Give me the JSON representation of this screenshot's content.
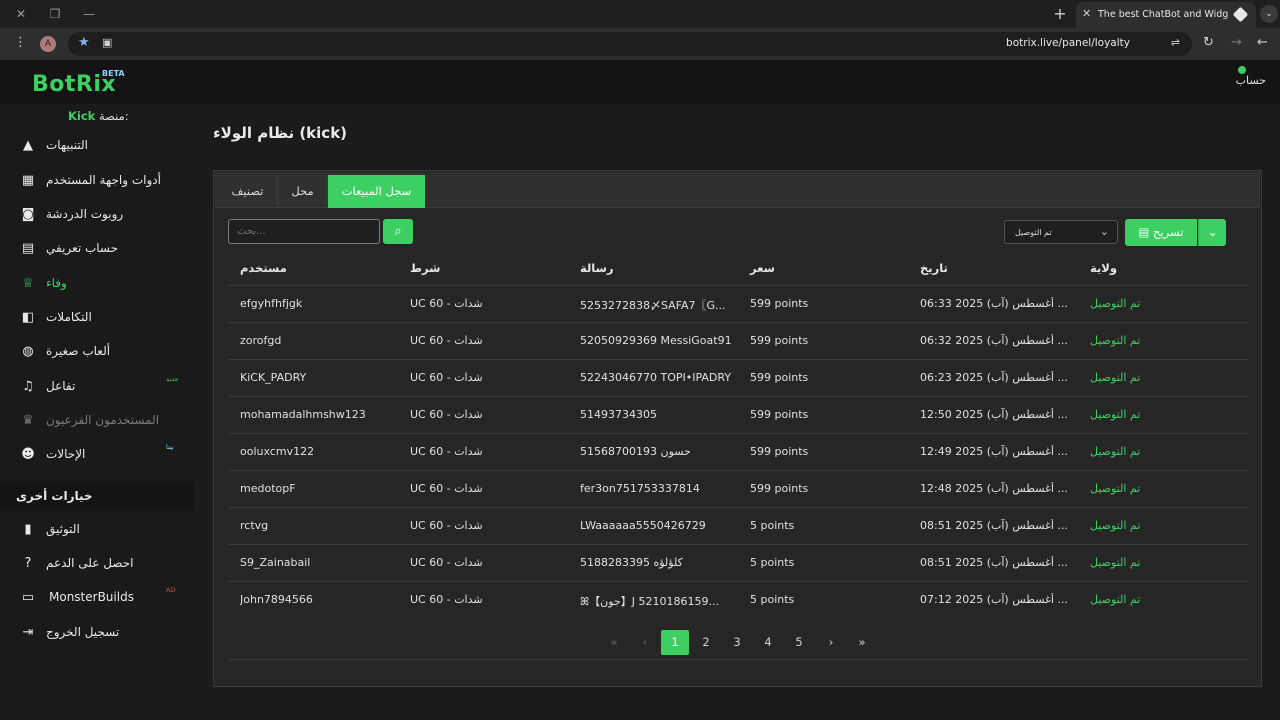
{
  "browser": {
    "tab_title": "The best ChatBot and Widgets",
    "url": "botrix.live/panel/loyalty",
    "profile_initial": "A"
  },
  "app": {
    "logo": "BotRix",
    "beta": "BETA",
    "account_label": "حساب"
  },
  "sidebar": {
    "platform_prefix": "منصة:",
    "platform_name": "Kick",
    "items": [
      {
        "label": "التنبيهات",
        "icon": "warning-icon"
      },
      {
        "label": "أدوات واجهة المستخدم",
        "icon": "widgets-icon"
      },
      {
        "label": "روبوت الدردشة",
        "icon": "robot-icon"
      },
      {
        "label": "حساب تعريفي",
        "icon": "id-card-icon"
      },
      {
        "label": "وفاء",
        "icon": "trophy-icon",
        "active": true
      },
      {
        "label": "التكاملات",
        "icon": "integrations-icon"
      },
      {
        "label": "ألعاب صغيرة",
        "icon": "gamepad-icon"
      },
      {
        "label": "تفاعل",
        "icon": "music-icon",
        "badge": "جديد"
      },
      {
        "label": "المستخدمون الفرعيون",
        "icon": "crown-icon",
        "disabled": true
      },
      {
        "label": "الإحالات",
        "icon": "users-icon",
        "badge": "بيتا"
      }
    ],
    "section_title": "خيارات أخرى",
    "other_items": [
      {
        "label": "التوثيق",
        "icon": "book-icon"
      },
      {
        "label": "احصل على الدعم",
        "icon": "question-icon"
      },
      {
        "label": "MonsterBuilds",
        "icon": "laptop-icon",
        "badge": "AD"
      },
      {
        "label": "تسجيل الخروج",
        "icon": "logout-icon"
      }
    ]
  },
  "main": {
    "title": "نظام الولاء (kick)",
    "tabs": [
      "سجل المبيعات",
      "محل",
      "تصنيف"
    ],
    "search_placeholder": "بحث...",
    "status_filter": "تم التوصيل",
    "export_label": "تسريح",
    "columns": [
      "ولاية",
      "تاريخ",
      "سعر",
      "رسالة",
      "شرط",
      "مستخدم"
    ],
    "rows": [
      {
        "state": "تم التوصيل",
        "date": "06:33 2025 (آب) أغسطس ...",
        "price": "599 points",
        "message": "5253272838〆SAFA7〖G...",
        "condition": "UC 60 - شدات",
        "user": "efgyhfhfjgk"
      },
      {
        "state": "تم التوصيل",
        "date": "06:32 2025 (آب) أغسطس ...",
        "price": "599 points",
        "message": "52050929369 MessiGoat91",
        "condition": "UC 60 - شدات",
        "user": "zorofgd"
      },
      {
        "state": "تم التوصيل",
        "date": "06:23 2025 (آب) أغسطس ...",
        "price": "599 points",
        "message": "52243046770 TOPI•IPADRY",
        "condition": "UC 60 - شدات",
        "user": "KiCK_PADRY"
      },
      {
        "state": "تم التوصيل",
        "date": "12:50 2025 (آب) أغسطس ...",
        "price": "599 points",
        "message": "51493734305",
        "condition": "UC 60 - شدات",
        "user": "mohamadalhmshw123"
      },
      {
        "state": "تم التوصيل",
        "date": "12:49 2025 (آب) أغسطس ...",
        "price": "599 points",
        "message": "51568700193 حسون",
        "condition": "UC 60 - شدات",
        "user": "ooluxcmv122"
      },
      {
        "state": "تم التوصيل",
        "date": "12:48 2025 (آب) أغسطس ...",
        "price": "599 points",
        "message": "fer3on751753337814",
        "condition": "UC 60 - شدات",
        "user": "medotopF"
      },
      {
        "state": "تم التوصيل",
        "date": "08:51 2025 (آب) أغسطس ...",
        "price": "5 points",
        "message": "LWaaaaaa5550426729",
        "condition": "UC 60 - شدات",
        "user": "rctvg"
      },
      {
        "state": "تم التوصيل",
        "date": "08:51 2025 (آب) أغسطس ...",
        "price": "5 points",
        "message": "5188283395 كلؤلؤه",
        "condition": "UC 60 - شدات",
        "user": "S9_Zainabail"
      },
      {
        "state": "تم التوصيل",
        "date": "07:12 2025 (آب) أغسطس ...",
        "price": "5 points",
        "message": "ꕤ【جون】J 5210186159...",
        "condition": "UC 60 - شدات",
        "user": "John7894566"
      }
    ],
    "pagination": {
      "first": "«",
      "prev": "‹",
      "pages": [
        "1",
        "2",
        "3",
        "4",
        "5"
      ],
      "current": "1",
      "next": "›",
      "last": "»"
    }
  },
  "colors": {
    "accent": "#3ecf63",
    "background": "#1b1b1b",
    "panel": "#262626"
  }
}
